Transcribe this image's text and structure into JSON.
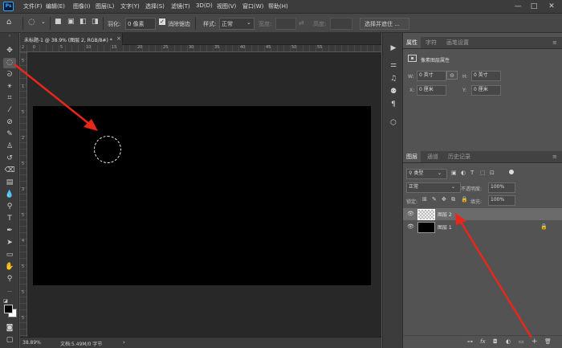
{
  "app": {
    "logo": "Ps"
  },
  "menu": [
    "文件(F)",
    "编辑(E)",
    "图像(I)",
    "图层(L)",
    "文字(Y)",
    "选择(S)",
    "滤镜(T)",
    "3D(D)",
    "视图(V)",
    "窗口(W)",
    "帮助(H)"
  ],
  "window_controls": {
    "minimize": "—",
    "maximize": "□",
    "close": "✕"
  },
  "options": {
    "feather_label": "羽化:",
    "feather_value": "0 像素",
    "antialias_label": "消除锯齿",
    "style_label": "样式:",
    "style_value": "正常",
    "width_label": "宽度:",
    "height_label": "高度:",
    "select_mask_button": "选择并遮住 ..."
  },
  "document": {
    "tab_title": "未标题-1 @ 38.9% (图层 2, RGB/8#) *",
    "tab_close": "×"
  },
  "status": {
    "zoom": "38.89%",
    "doc_info": "文档:5.49M/0 字节",
    "arrow": "›"
  },
  "ruler_top_ticks": [
    "2",
    "0",
    "5",
    "10",
    "15",
    "20",
    "25",
    "30",
    "35",
    "40",
    "45",
    "50",
    "55"
  ],
  "ruler_left_ticks": [
    "5",
    "1",
    "5",
    "2",
    "5",
    "3",
    "5",
    "4",
    "5",
    "5",
    "5"
  ],
  "properties_panel": {
    "tabs": [
      "属性",
      "字符",
      "画笔设置"
    ],
    "section_title": "像素图层属性",
    "w_label": "W:",
    "w_value": "0 英寸",
    "h_label": "H:",
    "h_value": "0 英寸",
    "x_label": "X:",
    "x_value": "0 厘米",
    "y_label": "Y:",
    "y_value": "0 厘米",
    "link_icon": "⊝"
  },
  "layers_panel": {
    "tabs": [
      "图层",
      "通道",
      "历史记录"
    ],
    "filter_value": "类型",
    "blend_mode": "正常",
    "opacity_label": "不透明度:",
    "opacity_value": "100%",
    "lock_label": "锁定:",
    "fill_label": "填充:",
    "fill_value": "100%",
    "layers": [
      {
        "name": "图层 2",
        "thumb": "transparent",
        "locked": false,
        "selected": true
      },
      {
        "name": "图层 1",
        "thumb": "black",
        "locked": true,
        "selected": false
      }
    ],
    "lock_icon": "🔒",
    "footer_icons": [
      "⊶",
      "fx",
      "◘",
      "◐",
      "▭",
      "+",
      "🗑"
    ]
  },
  "colors": {
    "accent": "#31a8ff",
    "arrow": "#e8271b",
    "canvas": "#000000",
    "pasteboard": "#282828"
  }
}
